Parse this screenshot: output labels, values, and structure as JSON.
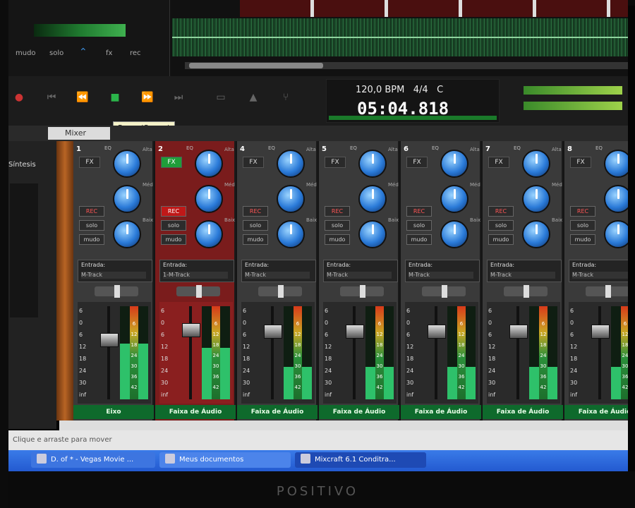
{
  "track": {
    "buttons": [
      "mudo",
      "solo",
      "fx",
      "rec"
    ]
  },
  "transport": {
    "tempo": "120,0 BPM",
    "meter": "4/4",
    "key": "C",
    "time": "05:04.818",
    "tooltip": "Parar (Space)"
  },
  "window": {
    "mixer_tab": "Mixer"
  },
  "left_panel": {
    "label": "Síntesis"
  },
  "mixer": {
    "eq_label": "EQ",
    "fx_label": "FX",
    "rec_label": "REC",
    "solo_label": "solo",
    "mudo_label": "mudo",
    "input_label": "Entrada:",
    "knob_labels": [
      "Alta",
      "Méd",
      "Baix"
    ],
    "fader_scale": [
      "6",
      "0",
      "6",
      "12",
      "18",
      "24",
      "30",
      "inf"
    ],
    "meter_scale": [
      "6",
      "12",
      "18",
      "24",
      "30",
      "36",
      "42"
    ],
    "strips": [
      {
        "number": "1",
        "input": "M-Track",
        "name": "Eixo"
      },
      {
        "number": "2",
        "input": "1-M-Track",
        "name": "Faixa de Áudio",
        "selected": true
      },
      {
        "number": "4",
        "input": "M-Track",
        "name": "Faixa de Áudio"
      },
      {
        "number": "5",
        "input": "M-Track",
        "name": "Faixa de Áudio"
      },
      {
        "number": "6",
        "input": "M-Track",
        "name": "Faixa de Áudio"
      },
      {
        "number": "7",
        "input": "M-Track",
        "name": "Faixa de Áudio"
      },
      {
        "number": "8",
        "input": "M-Track",
        "name": "Faixa de Áudio"
      }
    ]
  },
  "status": {
    "text": "Clique e arraste para mover"
  },
  "taskbar": {
    "items": [
      "D. of * - Vegas Movie ...",
      "Meus documentos",
      "Mixcraft 6.1 Conditra..."
    ]
  },
  "monitor": {
    "brand": "POSITIVO"
  }
}
